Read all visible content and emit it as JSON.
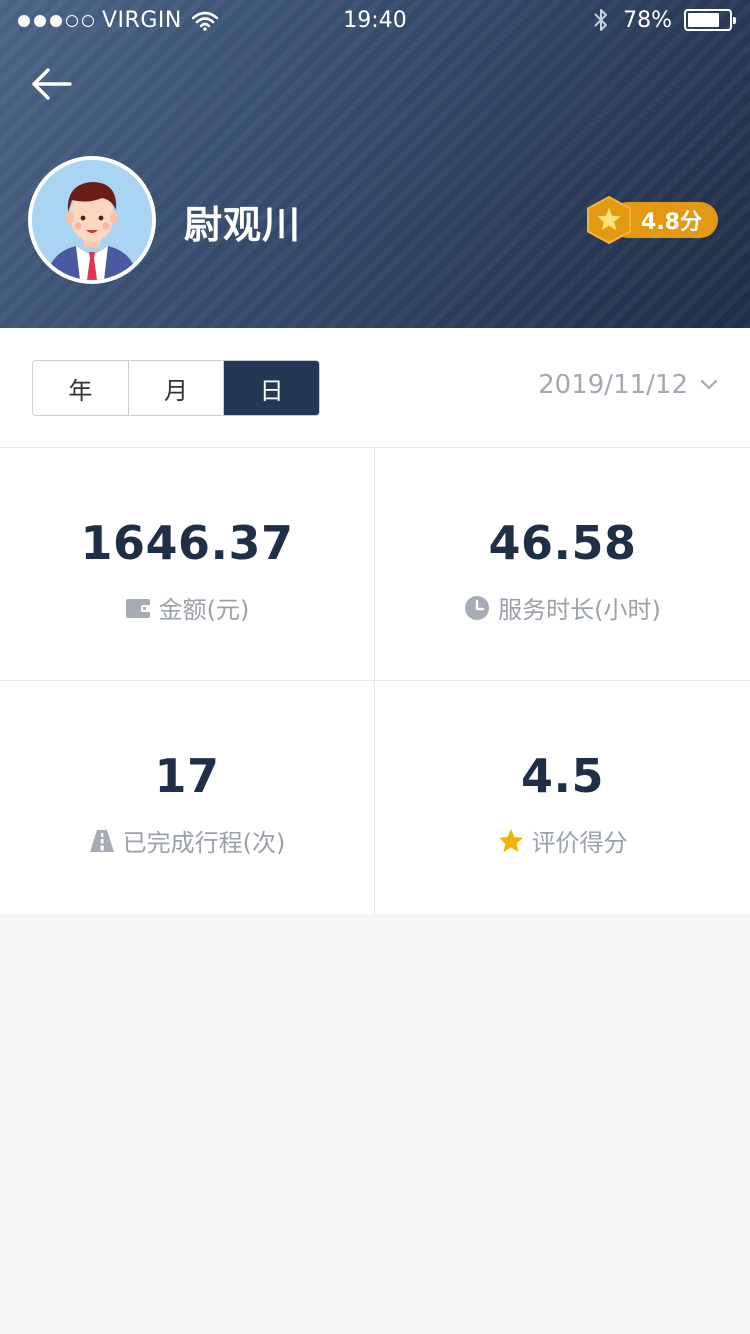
{
  "status_bar": {
    "carrier": "VIRGIN",
    "time": "19:40",
    "battery_percent_text": "78%",
    "battery_level": 0.78,
    "signal_bars_filled": 3,
    "signal_bars_total": 5
  },
  "header": {
    "user_name": "尉观川",
    "rating": "4.8分"
  },
  "filter": {
    "tabs": [
      {
        "label": "年",
        "active": false
      },
      {
        "label": "月",
        "active": false
      },
      {
        "label": "日",
        "active": true
      }
    ],
    "date": "2019/11/12"
  },
  "stats": [
    {
      "value": "1646.37",
      "label": "金额(元)",
      "icon": "wallet-icon"
    },
    {
      "value": "46.58",
      "label": "服务时长(小时)",
      "icon": "clock-icon"
    },
    {
      "value": "17",
      "label": "已完成行程(次)",
      "icon": "road-icon"
    },
    {
      "value": "4.5",
      "label": "评价得分",
      "icon": "star-icon"
    }
  ],
  "colors": {
    "header_dark": "#1f2d46",
    "accent_navy": "#243753",
    "badge_orange": "#e39a12",
    "star_yellow": "#f5b400",
    "muted_text": "#9ba1ab"
  }
}
